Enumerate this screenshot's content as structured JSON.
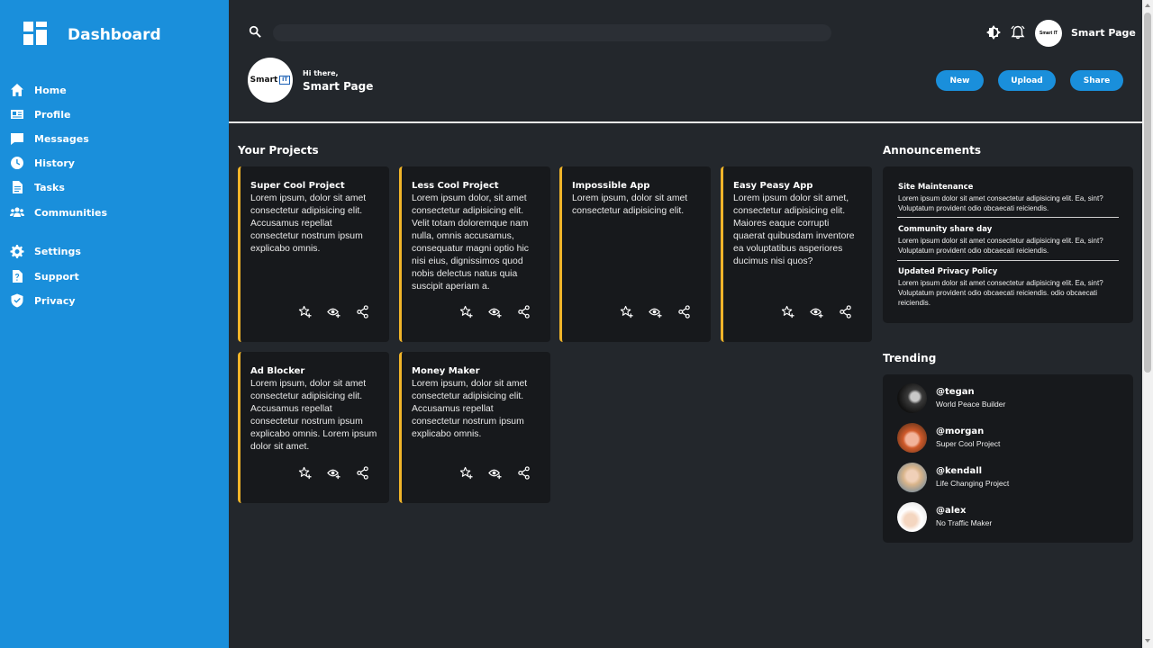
{
  "sidebar": {
    "brand": "Dashboard",
    "items": [
      {
        "label": "Home",
        "icon": "home-icon"
      },
      {
        "label": "Profile",
        "icon": "id-card-icon"
      },
      {
        "label": "Messages",
        "icon": "message-icon"
      },
      {
        "label": "History",
        "icon": "clock-icon"
      },
      {
        "label": "Tasks",
        "icon": "document-icon"
      },
      {
        "label": "Communities",
        "icon": "people-icon"
      },
      {
        "label": "Settings",
        "icon": "gear-icon"
      },
      {
        "label": "Support",
        "icon": "help-document-icon"
      },
      {
        "label": "Privacy",
        "icon": "shield-check-icon"
      }
    ]
  },
  "topbar": {
    "search_placeholder": "",
    "user_name": "Smart Page"
  },
  "profile": {
    "greeting": "Hi there,",
    "name": "Smart Page",
    "logo_text": "Smart",
    "logo_badge": "IT"
  },
  "actions": {
    "new": "New",
    "upload": "Upload",
    "share": "Share"
  },
  "projects": {
    "title": "Your Projects",
    "items": [
      {
        "title": "Super Cool Project",
        "desc": "Lorem ipsum, dolor sit amet consectetur adipisicing elit. Accusamus repellat consectetur nostrum ipsum explicabo omnis."
      },
      {
        "title": "Less Cool Project",
        "desc": "Lorem ipsum dolor, sit amet consectetur adipisicing elit. Velit totam doloremque nam nulla, omnis accusamus, consequatur magni optio hic nisi eius, dignissimos quod nobis delectus natus quia suscipit aperiam a."
      },
      {
        "title": "Impossible App",
        "desc": "Lorem ipsum, dolor sit amet consectetur adipisicing elit."
      },
      {
        "title": "Easy Peasy App",
        "desc": "Lorem ipsum dolor sit amet, consectetur adipisicing elit. Maiores eaque corrupti quaerat quibusdam inventore ea voluptatibus asperiores ducimus nisi quos?"
      },
      {
        "title": "Ad Blocker",
        "desc": "Lorem ipsum, dolor sit amet consectetur adipisicing elit. Accusamus repellat consectetur nostrum ipsum explicabo omnis. Lorem ipsum dolor sit amet."
      },
      {
        "title": "Money Maker",
        "desc": "Lorem ipsum, dolor sit amet consectetur adipisicing elit. Accusamus repellat consectetur nostrum ipsum explicabo omnis."
      }
    ]
  },
  "announcements": {
    "title": "Announcements",
    "items": [
      {
        "title": "Site Maintenance",
        "body": "Lorem ipsum dolor sit amet consectetur adipisicing elit. Ea, sint? Voluptatum provident odio obcaecati reiciendis."
      },
      {
        "title": "Community share day",
        "body": "Lorem ipsum dolor sit amet consectetur adipisicing elit. Ea, sint? Voluptatum provident odio obcaecati reiciendis."
      },
      {
        "title": "Updated Privacy Policy",
        "body": "Lorem ipsum dolor sit amet consectetur adipisicing elit. Ea, sint? Voluptatum provident odio obcaecati reiciendis. odio obcaecati reiciendis."
      }
    ]
  },
  "trending": {
    "title": "Trending",
    "items": [
      {
        "handle": "@tegan",
        "project": "World Peace Builder"
      },
      {
        "handle": "@morgan",
        "project": "Super Cool Project"
      },
      {
        "handle": "@kendall",
        "project": "Life Changing Project"
      },
      {
        "handle": "@alex",
        "project": "No Traffic Maker"
      }
    ]
  },
  "colors": {
    "accent": "#1a8fdb",
    "card_border": "#f0b429",
    "background": "#23272c",
    "card_bg": "#17191c"
  }
}
